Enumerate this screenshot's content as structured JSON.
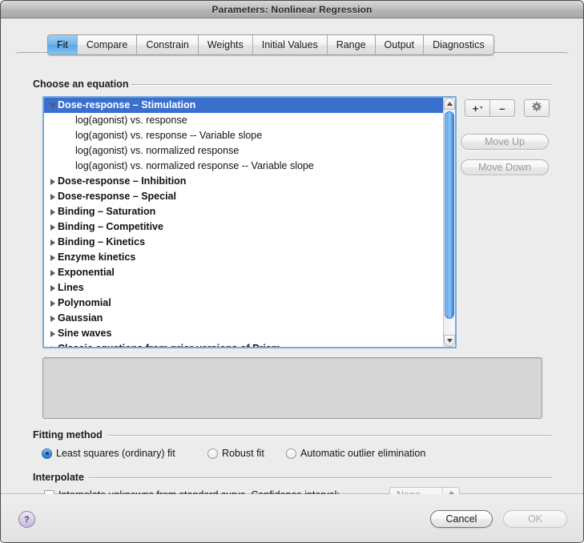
{
  "window": {
    "title": "Parameters: Nonlinear Regression"
  },
  "tabs": [
    {
      "label": "Fit",
      "active": true
    },
    {
      "label": "Compare",
      "active": false
    },
    {
      "label": "Constrain",
      "active": false
    },
    {
      "label": "Weights",
      "active": false
    },
    {
      "label": "Initial Values",
      "active": false
    },
    {
      "label": "Range",
      "active": false
    },
    {
      "label": "Output",
      "active": false
    },
    {
      "label": "Diagnostics",
      "active": false
    }
  ],
  "equation_section": {
    "label": "Choose an equation",
    "list": [
      {
        "text": "Dose-response – Stimulation",
        "type": "category",
        "expanded": true,
        "selected": true
      },
      {
        "text": "log(agonist) vs. response",
        "type": "child",
        "selected": false
      },
      {
        "text": "log(agonist) vs. response -- Variable slope",
        "type": "child",
        "selected": false
      },
      {
        "text": "log(agonist) vs. normalized response",
        "type": "child",
        "selected": false
      },
      {
        "text": "log(agonist) vs. normalized response -- Variable slope",
        "type": "child",
        "selected": false
      },
      {
        "text": "Dose-response – Inhibition",
        "type": "category",
        "expanded": false,
        "selected": false
      },
      {
        "text": "Dose-response – Special",
        "type": "category",
        "expanded": false,
        "selected": false
      },
      {
        "text": "Binding – Saturation",
        "type": "category",
        "expanded": false,
        "selected": false
      },
      {
        "text": "Binding – Competitive",
        "type": "category",
        "expanded": false,
        "selected": false
      },
      {
        "text": "Binding – Kinetics",
        "type": "category",
        "expanded": false,
        "selected": false
      },
      {
        "text": "Enzyme kinetics",
        "type": "category",
        "expanded": false,
        "selected": false
      },
      {
        "text": "Exponential",
        "type": "category",
        "expanded": false,
        "selected": false
      },
      {
        "text": "Lines",
        "type": "category",
        "expanded": false,
        "selected": false
      },
      {
        "text": "Polynomial",
        "type": "category",
        "expanded": false,
        "selected": false
      },
      {
        "text": "Gaussian",
        "type": "category",
        "expanded": false,
        "selected": false
      },
      {
        "text": "Sine waves",
        "type": "category",
        "expanded": false,
        "selected": false
      },
      {
        "text": "Classic equations from prior versions of Prism",
        "type": "category",
        "expanded": false,
        "selected": false
      }
    ],
    "description": ""
  },
  "side_buttons": {
    "add_label": "+",
    "add_caret": "▾",
    "remove_label": "–",
    "gear_label": "gear",
    "move_up_label": "Move Up",
    "move_down_label": "Move Down"
  },
  "fitting_method": {
    "label": "Fitting method",
    "options": [
      {
        "label": "Least squares (ordinary) fit",
        "selected": true
      },
      {
        "label": "Robust fit",
        "selected": false
      },
      {
        "label": "Automatic outlier elimination",
        "selected": false
      }
    ]
  },
  "interpolate": {
    "label": "Interpolate",
    "checkbox_label": "Interpolate unknowns from standard curve. Confidence interval:",
    "checked": false,
    "confidence_interval_value": "None"
  },
  "footer": {
    "help_label": "?",
    "cancel_label": "Cancel",
    "ok_label": "OK"
  },
  "colors": {
    "selection_blue": "#3a6fcd",
    "tab_active_blue": "#5aa9e8",
    "focus_ring": "#76a9df"
  }
}
